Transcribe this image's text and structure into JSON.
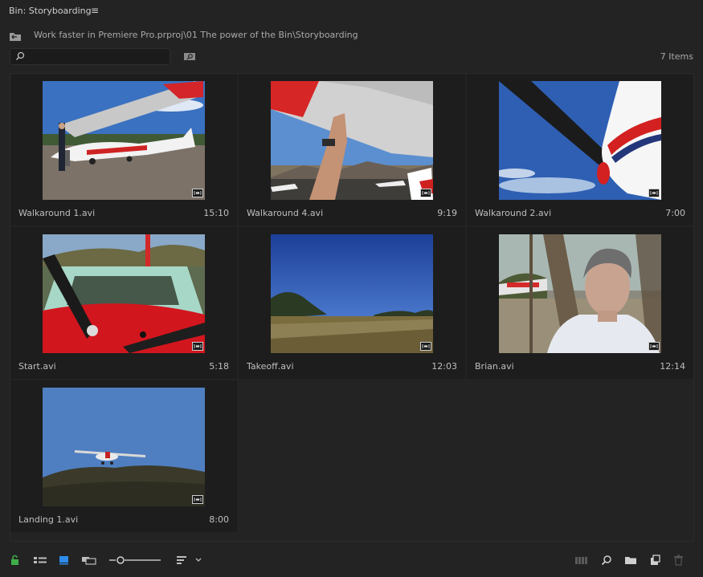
{
  "panel": {
    "title": "Bin: Storyboarding",
    "menu_icon": "hamburger-icon"
  },
  "path": {
    "text": "Work faster in Premiere Pro.prproj\\01 The power of the Bin\\Storyboarding"
  },
  "search": {
    "value": "",
    "placeholder": ""
  },
  "item_count": "7 Items",
  "clips": [
    {
      "name": "Walkaround 1.avi",
      "duration": "15:10",
      "scene": "plane-walkaround-1"
    },
    {
      "name": "Walkaround 4.avi",
      "duration": "9:19",
      "scene": "wing-hand"
    },
    {
      "name": "Walkaround 2.avi",
      "duration": "7:00",
      "scene": "propeller-sky"
    },
    {
      "name": "Start.avi",
      "duration": "5:18",
      "scene": "cockpit-propeller"
    },
    {
      "name": "Takeoff.avi",
      "duration": "12:03",
      "scene": "runway-field"
    },
    {
      "name": "Brian.avi",
      "duration": "12:14",
      "scene": "man-portrait"
    },
    {
      "name": "Landing 1.avi",
      "duration": "8:00",
      "scene": "plane-flying"
    }
  ],
  "colors": {
    "accent_green": "#3fae49",
    "accent_blue": "#2d8ceb",
    "panel_bg": "#232323",
    "cell_bg": "#1d1d1d"
  }
}
